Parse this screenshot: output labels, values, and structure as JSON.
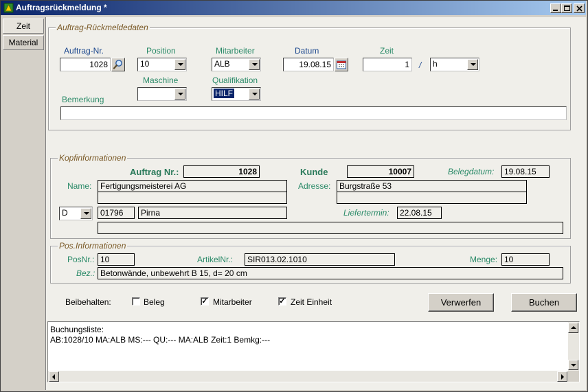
{
  "window": {
    "title": "Auftragsrückmeldung  *"
  },
  "sidebar": {
    "tabs": [
      {
        "label": "Zeit"
      },
      {
        "label": "Material"
      }
    ]
  },
  "rueckmeldung": {
    "legend": "Auftrag-Rückmeldedaten",
    "auftrag_label": "Auftrag-Nr.",
    "auftrag_value": "1028",
    "position_label": "Position",
    "position_value": "10",
    "mitarbeiter_label": "Mitarbeiter",
    "mitarbeiter_value": "ALB",
    "datum_label": "Datum",
    "datum_value": "19.08.15",
    "zeit_label": "Zeit",
    "zeit_value": "1",
    "zeit_sep": "/",
    "einheit_value": "h",
    "maschine_label": "Maschine",
    "maschine_value": "",
    "qualifikation_label": "Qualifikation",
    "qualifikation_value": "HILF",
    "bemerkung_label": "Bemerkung",
    "bemerkung_value": ""
  },
  "kopf": {
    "legend": "Kopfinformationen",
    "auftrag_label": "Auftrag Nr.:",
    "auftrag_value": "1028",
    "kunde_label": "Kunde",
    "kunde_value": "10007",
    "belegdatum_label": "Belegdatum:",
    "belegdatum_value": "19.08.15",
    "name_label": "Name:",
    "name1": "Fertigungsmeisterei AG",
    "name2": "",
    "adresse_label": "Adresse:",
    "adresse1": "Burgstraße 53",
    "adresse2": "",
    "land_value": "D",
    "plz_value": "01796",
    "ort_value": "Pirna",
    "liefertermin_label": "Liefertermin:",
    "liefertermin_value": "22.08.15",
    "extra_value": ""
  },
  "pos": {
    "legend": "Pos.Informationen",
    "posnr_label": "PosNr.:",
    "posnr_value": "10",
    "artikel_label": "ArtikelNr.:",
    "artikel_value": "SIR013.02.1010",
    "menge_label": "Menge:",
    "menge_value": "10",
    "bez_label": "Bez.:",
    "bez_value": "Betonwände, unbewehrt B 15, d= 20 cm"
  },
  "beibehalten": {
    "label": "Beibehalten:",
    "beleg": {
      "label": "Beleg",
      "mark": ""
    },
    "mitarbeiter": {
      "label": "Mitarbeiter",
      "mark": "✓"
    },
    "zeit_einheit": {
      "label": "Zeit Einheit",
      "mark": "✓"
    }
  },
  "buttons": {
    "verwerfen": "Verwerfen",
    "buchen": "Buchen"
  },
  "buchungsliste": {
    "line1": "Buchungsliste:",
    "line2": "AB:1028/10  MA:ALB  MS:---  QU:---  MA:ALB  Zeit:1  Bemkg:---"
  }
}
